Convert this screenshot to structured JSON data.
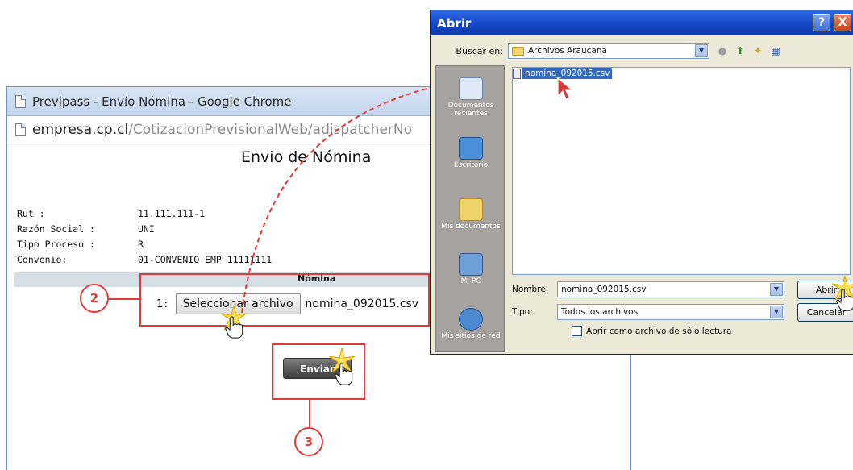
{
  "chrome": {
    "title": "Previpass - Envío Nómina - Google Chrome",
    "url_host": "empresa.cp.cl",
    "url_path": "/CotizacionPrevisionalWeb/adispatcherNo"
  },
  "page": {
    "title": "Envio de Nómina",
    "fields": [
      {
        "label": "Rut :",
        "value": "11.111.111-1"
      },
      {
        "label": "Razón Social :",
        "value": "UNI"
      },
      {
        "label": "Tipo Proceso :",
        "value": "R"
      },
      {
        "label": "Convenio:",
        "value": "01-CONVENIO EMP 11111111"
      }
    ],
    "nomina_header": "Nómina",
    "file_index": "1:",
    "select_file_button": "Seleccionar archivo",
    "selected_file_name": "nomina_092015.csv",
    "send_button": "Enviar"
  },
  "markers": {
    "step_2": "2",
    "step_3": "3"
  },
  "dialog": {
    "title": "Abrir",
    "help_button": "?",
    "close_button": "X",
    "look_in_label": "Buscar en:",
    "look_in_value": "Archivos Araucana",
    "places": [
      {
        "label": "Documentos recientes",
        "icon": "recent-documents-icon"
      },
      {
        "label": "Escritorio",
        "icon": "desktop-icon"
      },
      {
        "label": "Mis documentos",
        "icon": "my-documents-icon"
      },
      {
        "label": "Mi PC",
        "icon": "my-computer-icon"
      },
      {
        "label": "Mis sitios de red",
        "icon": "network-places-icon"
      }
    ],
    "files": [
      {
        "name": "nomina_092015.csv",
        "selected": true
      }
    ],
    "filename_label": "Nombre:",
    "filename_value": "nomina_092015.csv",
    "filetype_label": "Tipo:",
    "filetype_value": "Todos los archivos",
    "readonly_checkbox_label": "Abrir como archivo de sólo lectura",
    "open_button": "Abrir",
    "cancel_button": "Cancelar"
  },
  "colors": {
    "annotation_red": "#e03a3a",
    "dialog_title_blue": "#1546c6",
    "selection_blue": "#316ac5"
  }
}
